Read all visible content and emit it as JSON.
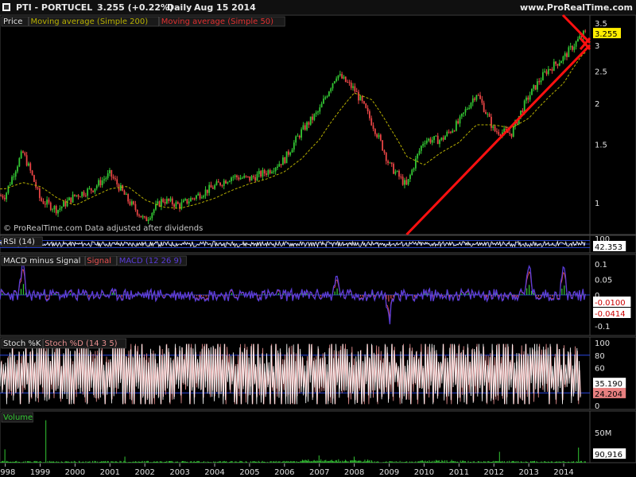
{
  "header": {
    "symbol": "PTI - PORTUCEL",
    "quote": "3.255 (+0.22%)",
    "period": "Daily",
    "date": "Aug 15 2014",
    "site": "www.ProRealTime.com"
  },
  "colors": {
    "background": "#000000",
    "bull": "#33c633",
    "bear": "#e84545",
    "ma200": "#b8b000",
    "ma50": "#e03030",
    "trendline": "#ff1010",
    "rsi_line": "#ffffff",
    "macd_line": "#5a3cd8",
    "signal_line": "#e85050",
    "hist_pos": "#33c633",
    "hist_neg": "#e05050",
    "stoch_k": "#ffffff",
    "stoch_d": "#e89090",
    "level_line": "#3050ff",
    "volume": "#33c633"
  },
  "watermark": "© ProRealTime.com  Data adjusted after dividends",
  "chart_data": [
    {
      "id": "price",
      "type": "candlestick",
      "title": "Price",
      "legend": [
        "Price",
        "Moving average (Simple 200)",
        "Moving average (Simple 50)"
      ],
      "y_scale": "log",
      "ylim": [
        0.8,
        3.7
      ],
      "yticks": [
        "3.5",
        "3",
        "2.5",
        "2",
        "1.5",
        "1"
      ],
      "ytick_values": [
        3.5,
        3,
        2.5,
        2,
        1.5,
        1
      ],
      "last_value": "3.255",
      "x_dates": [
        "1998-01",
        "1998-07",
        "1999-01",
        "1999-07",
        "2000-01",
        "2000-07",
        "2001-01",
        "2001-07",
        "2002-01",
        "2002-07",
        "2003-01",
        "2003-07",
        "2004-01",
        "2004-07",
        "2005-01",
        "2005-07",
        "2006-01",
        "2006-07",
        "2007-01",
        "2007-07",
        "2008-01",
        "2008-07",
        "2009-01",
        "2009-07",
        "2010-01",
        "2010-07",
        "2011-01",
        "2011-07",
        "2012-01",
        "2012-07",
        "2013-01",
        "2013-07",
        "2014-01",
        "2014-08"
      ],
      "close": [
        1.05,
        1.42,
        1.02,
        0.95,
        1.05,
        1.1,
        1.22,
        1.02,
        0.88,
        1.02,
        0.98,
        1.05,
        1.12,
        1.2,
        1.18,
        1.24,
        1.35,
        1.65,
        1.9,
        2.45,
        2.2,
        1.75,
        1.3,
        1.12,
        1.55,
        1.55,
        1.75,
        2.15,
        1.65,
        1.62,
        2.1,
        2.5,
        2.75,
        3.255
      ],
      "ma200": [
        1.1,
        1.15,
        1.12,
        1.03,
        0.98,
        1.04,
        1.1,
        1.12,
        1.02,
        0.97,
        0.96,
        0.99,
        1.03,
        1.09,
        1.14,
        1.18,
        1.24,
        1.36,
        1.55,
        1.85,
        2.15,
        2.05,
        1.7,
        1.38,
        1.3,
        1.42,
        1.52,
        1.72,
        1.72,
        1.68,
        1.8,
        2.05,
        2.3,
        2.85
      ],
      "trendline": {
        "x_start": "2009-07",
        "x_end": "2014-08"
      },
      "x_axis_labels": [
        "1998",
        "1999",
        "2000",
        "2001",
        "2002",
        "2003",
        "2004",
        "2005",
        "2006",
        "2007",
        "2008",
        "2009",
        "2010",
        "2011",
        "2012",
        "2013",
        "2014"
      ]
    },
    {
      "id": "rsi",
      "type": "line",
      "title": "RSI (14)",
      "ylim": [
        0,
        100
      ],
      "yticks": [
        "100"
      ],
      "last_value": "42.353"
    },
    {
      "id": "macd",
      "type": "line+histogram",
      "title": "MACD minus Signal",
      "legend": [
        "MACD minus Signal",
        "Signal",
        "MACD (12 26 9)"
      ],
      "ylim": [
        -0.13,
        0.13
      ],
      "yticks": [
        "0.1",
        "0.05",
        "0",
        "-0.05",
        "-0.1"
      ],
      "ytick_values": [
        0.1,
        0.05,
        0,
        -0.05,
        -0.1
      ],
      "last_values": [
        "-0.0100",
        "-0.0414"
      ],
      "spikes": [
        {
          "x": "1998-07",
          "value": 0.1
        },
        {
          "x": "2007-07",
          "value": 0.06
        },
        {
          "x": "2009-01",
          "value": -0.09
        },
        {
          "x": "2013-01",
          "value": 0.11
        },
        {
          "x": "2014-01",
          "value": 0.09
        }
      ]
    },
    {
      "id": "stoch",
      "type": "line",
      "title": "Stoch %K",
      "legend": [
        "Stoch %K",
        "Stoch %D (14 3 5)"
      ],
      "ylim": [
        0,
        100
      ],
      "yticks": [
        "100",
        "80",
        "60",
        "40",
        "20",
        "0"
      ],
      "ytick_values": [
        100,
        80,
        60,
        40,
        20,
        0
      ],
      "levels": [
        80,
        20
      ],
      "last_values": [
        "35.190",
        "24.204"
      ]
    },
    {
      "id": "volume",
      "type": "bar",
      "title": "Volume",
      "yticks": [
        "50M"
      ],
      "ylim": [
        0,
        80
      ],
      "unit": "M",
      "last_value": "90,916",
      "spikes": [
        {
          "x": "1999-03",
          "value": 70
        },
        {
          "x": "1998-01",
          "value": 22
        },
        {
          "x": "2001-06",
          "value": 10
        },
        {
          "x": "2007-01",
          "value": 12
        },
        {
          "x": "2008-01",
          "value": 10
        },
        {
          "x": "2012-03",
          "value": 18
        },
        {
          "x": "2014-06",
          "value": 25
        }
      ]
    }
  ]
}
